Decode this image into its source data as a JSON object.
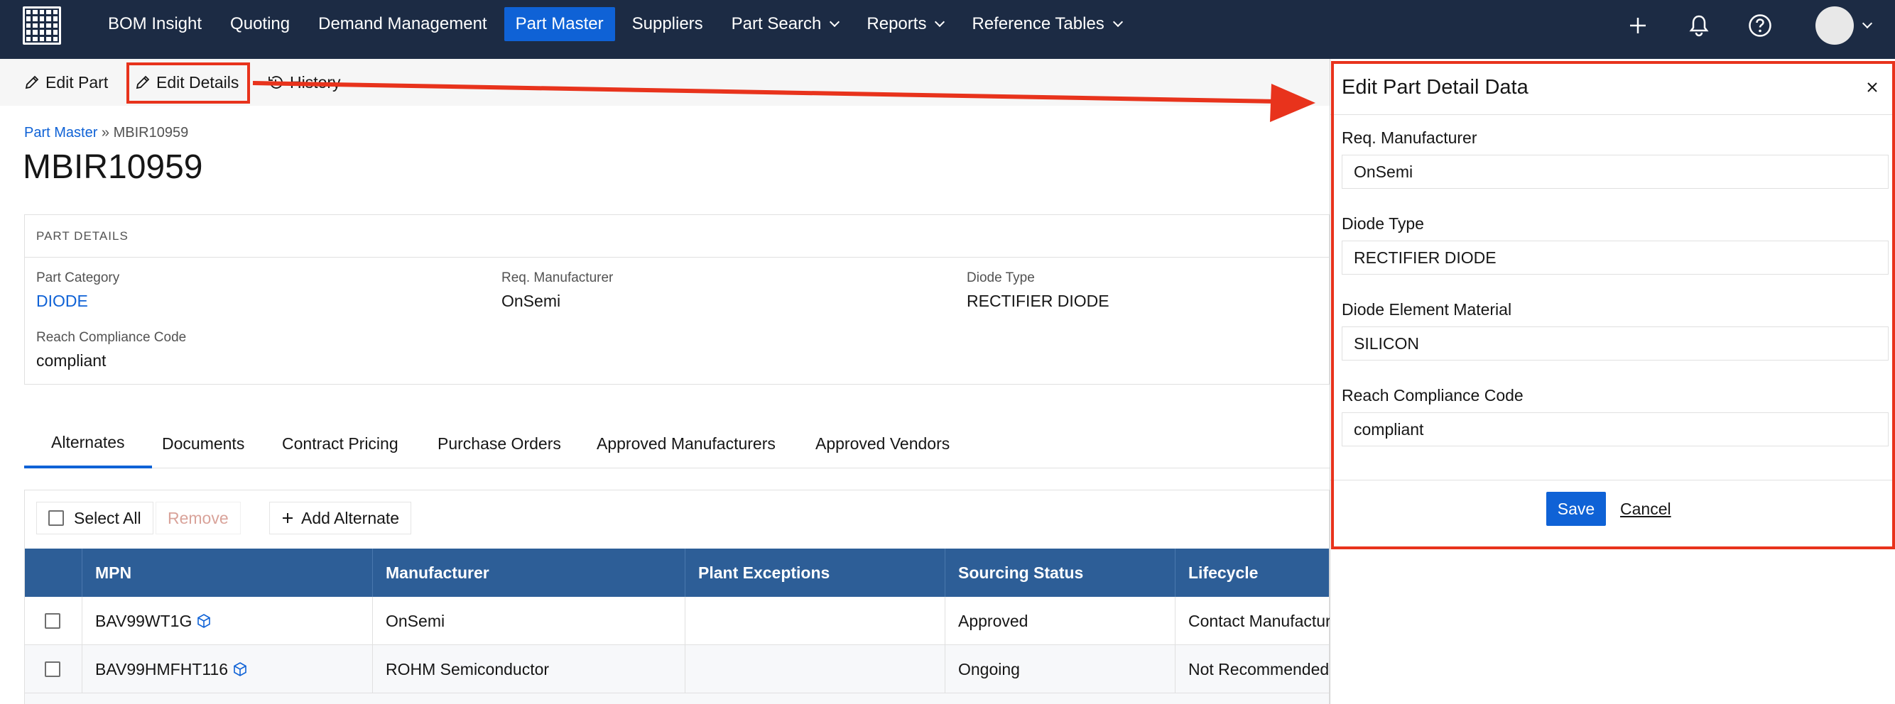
{
  "nav": {
    "items": [
      {
        "label": "BOM Insight",
        "dropdown": false,
        "active": false
      },
      {
        "label": "Quoting",
        "dropdown": false,
        "active": false
      },
      {
        "label": "Demand Management",
        "dropdown": false,
        "active": false
      },
      {
        "label": "Part Master",
        "dropdown": false,
        "active": true
      },
      {
        "label": "Suppliers",
        "dropdown": false,
        "active": false
      },
      {
        "label": "Part Search",
        "dropdown": true,
        "active": false
      },
      {
        "label": "Reports",
        "dropdown": true,
        "active": false
      },
      {
        "label": "Reference Tables",
        "dropdown": true,
        "active": false
      }
    ],
    "active_color": "#0f62d6",
    "background": "#1c2b44",
    "right_icons": [
      "plus-icon",
      "bell-icon",
      "help-icon"
    ]
  },
  "toolbar": {
    "edit_part": "Edit Part",
    "edit_details": "Edit Details",
    "history": "History"
  },
  "breadcrumb": {
    "root": "Part Master",
    "separator": " » ",
    "current": "MBIR10959"
  },
  "page": {
    "title": "MBIR10959"
  },
  "part_details": {
    "header": "PART DETAILS",
    "fields": [
      {
        "label": "Part Category",
        "value": "DIODE"
      },
      {
        "label": "Req. Manufacturer",
        "value": "OnSemi"
      },
      {
        "label": "Diode Type",
        "value": "RECTIFIER DIODE"
      },
      {
        "label": "Reach Compliance Code",
        "value": "compliant"
      }
    ]
  },
  "tabs": [
    {
      "label": "Alternates",
      "active": true
    },
    {
      "label": "Documents",
      "active": false
    },
    {
      "label": "Contract Pricing",
      "active": false
    },
    {
      "label": "Purchase Orders",
      "active": false
    },
    {
      "label": "Approved Manufacturers",
      "active": false
    },
    {
      "label": "Approved Vendors",
      "active": false
    }
  ],
  "table": {
    "select_all": "Select All",
    "remove": "Remove",
    "add_alternate": "Add Alternate",
    "columns": [
      "MPN",
      "Manufacturer",
      "Plant Exceptions",
      "Sourcing Status",
      "Lifecycle"
    ],
    "rows": [
      {
        "mpn": "BAV99WT1G",
        "manufacturer": "OnSemi",
        "plant_exceptions": "",
        "sourcing_status": "Approved",
        "lifecycle": "Contact Manufacturer"
      },
      {
        "mpn": "BAV99HMFHT116",
        "manufacturer": "ROHM Semiconductor",
        "plant_exceptions": "",
        "sourcing_status": "Ongoing",
        "lifecycle": "Not Recommended"
      }
    ],
    "header_color": "#2d5e97"
  },
  "panel": {
    "title": "Edit Part Detail Data",
    "fields": [
      {
        "label": "Req. Manufacturer",
        "value": "OnSemi"
      },
      {
        "label": "Diode Type",
        "value": "RECTIFIER DIODE"
      },
      {
        "label": "Diode Element Material",
        "value": "SILICON"
      },
      {
        "label": "Reach Compliance Code",
        "value": "compliant"
      }
    ],
    "save": "Save",
    "cancel": "Cancel"
  },
  "annotation_color": "#e8331c"
}
